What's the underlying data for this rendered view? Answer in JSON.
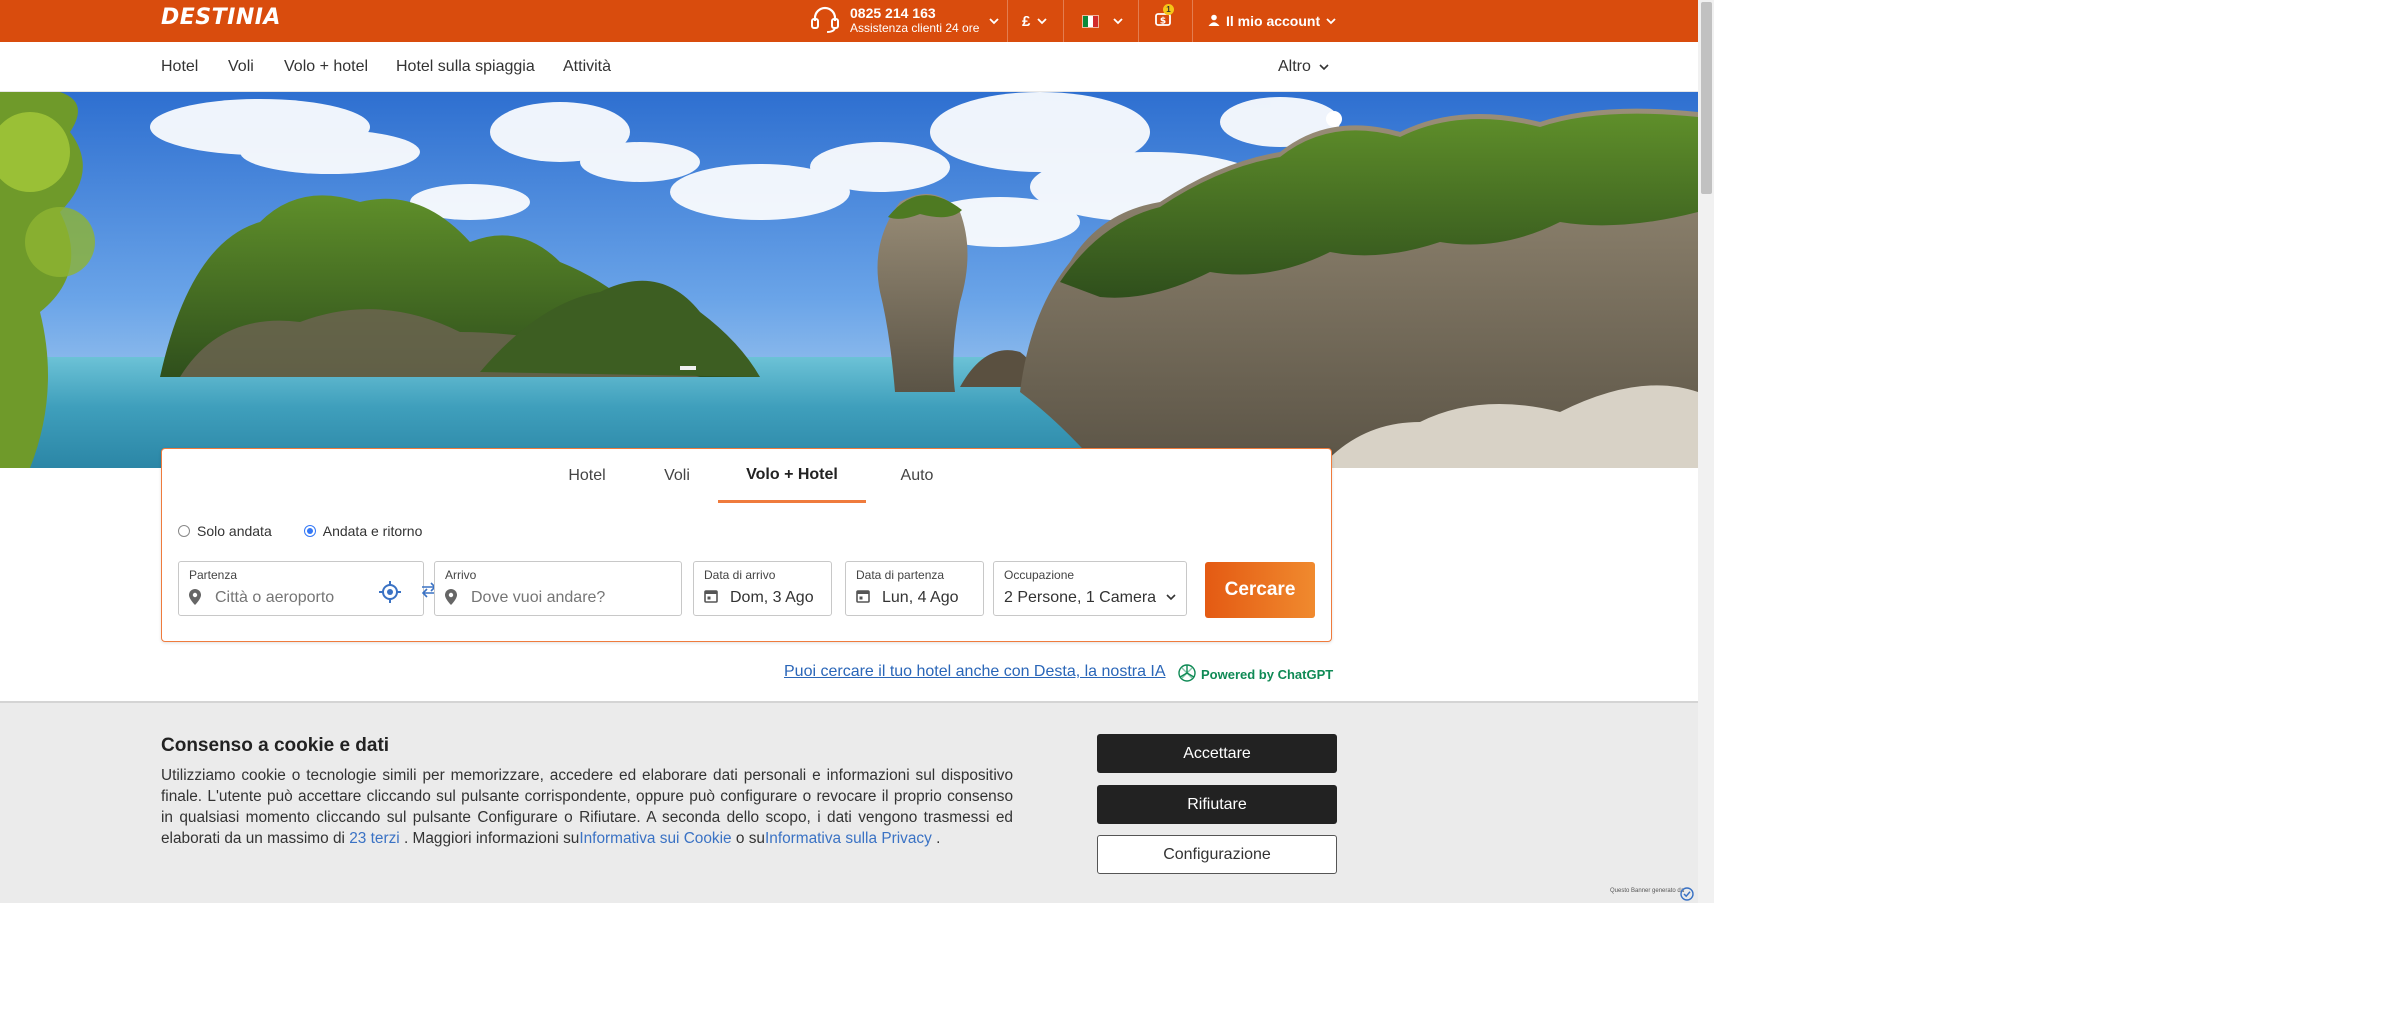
{
  "brand": {
    "logo_text": "DESTINIA",
    "accent": "#d94c0d"
  },
  "topbar": {
    "phone_number": "0825 214 163",
    "phone_caption": "Assistenza clienti 24 ore",
    "currency": "£",
    "language_flag": "italy-flag",
    "notifications_count": "1",
    "account_label": "Il mio account"
  },
  "nav": {
    "items": [
      "Hotel",
      "Voli",
      "Volo + hotel",
      "Hotel sulla spiaggia",
      "Attività"
    ],
    "more_label": "Altro"
  },
  "search": {
    "tabs": [
      "Hotel",
      "Voli",
      "Volo + Hotel",
      "Auto"
    ],
    "active_tab": "Volo + Hotel",
    "trip_types": [
      "Solo andata",
      "Andata e ritorno"
    ],
    "selected_trip_type": "Andata e ritorno",
    "departure": {
      "label": "Partenza",
      "placeholder": "Città o aeroporto"
    },
    "arrival": {
      "label": "Arrivo",
      "placeholder": "Dove vuoi andare?"
    },
    "checkin": {
      "label": "Data di arrivo",
      "value": "Dom, 3 Ago"
    },
    "checkout": {
      "label": "Data di partenza",
      "value": "Lun, 4 Ago"
    },
    "occupancy": {
      "label": "Occupazione",
      "value": "2 Persone, 1 Camera"
    },
    "submit_label": "Cercare"
  },
  "ai": {
    "link_text": "Puoi cercare il tuo hotel anche con Desta, la nostra IA",
    "powered_text": "Powered by ChatGPT"
  },
  "cookie": {
    "title": "Consenso a cookie e dati",
    "body_1": "Utilizziamo cookie o tecnologie simili per memorizzare, accedere ed elaborare dati personali e informazioni sul dispositivo finale. L'utente può accettare cliccando sul pulsante corrispondente, oppure può configurare o revocare il proprio consenso in qualsiasi momento cliccando sul pulsante Configurare o Rifiutare. A seconda dello scopo, i dati vengono trasmessi ed elaborati da un massimo di",
    "third_parties_link": "23 terzi",
    "body_2": ". Maggiori informazioni su",
    "cookie_policy_link": "Informativa sui Cookie",
    "body_3": "o su",
    "privacy_policy_link": "Informativa sulla Privacy",
    "body_4": ".",
    "accept_label": "Accettare",
    "reject_label": "Rifiutare",
    "configure_label": "Configurazione",
    "footer_text": "Questo Banner generato da"
  }
}
